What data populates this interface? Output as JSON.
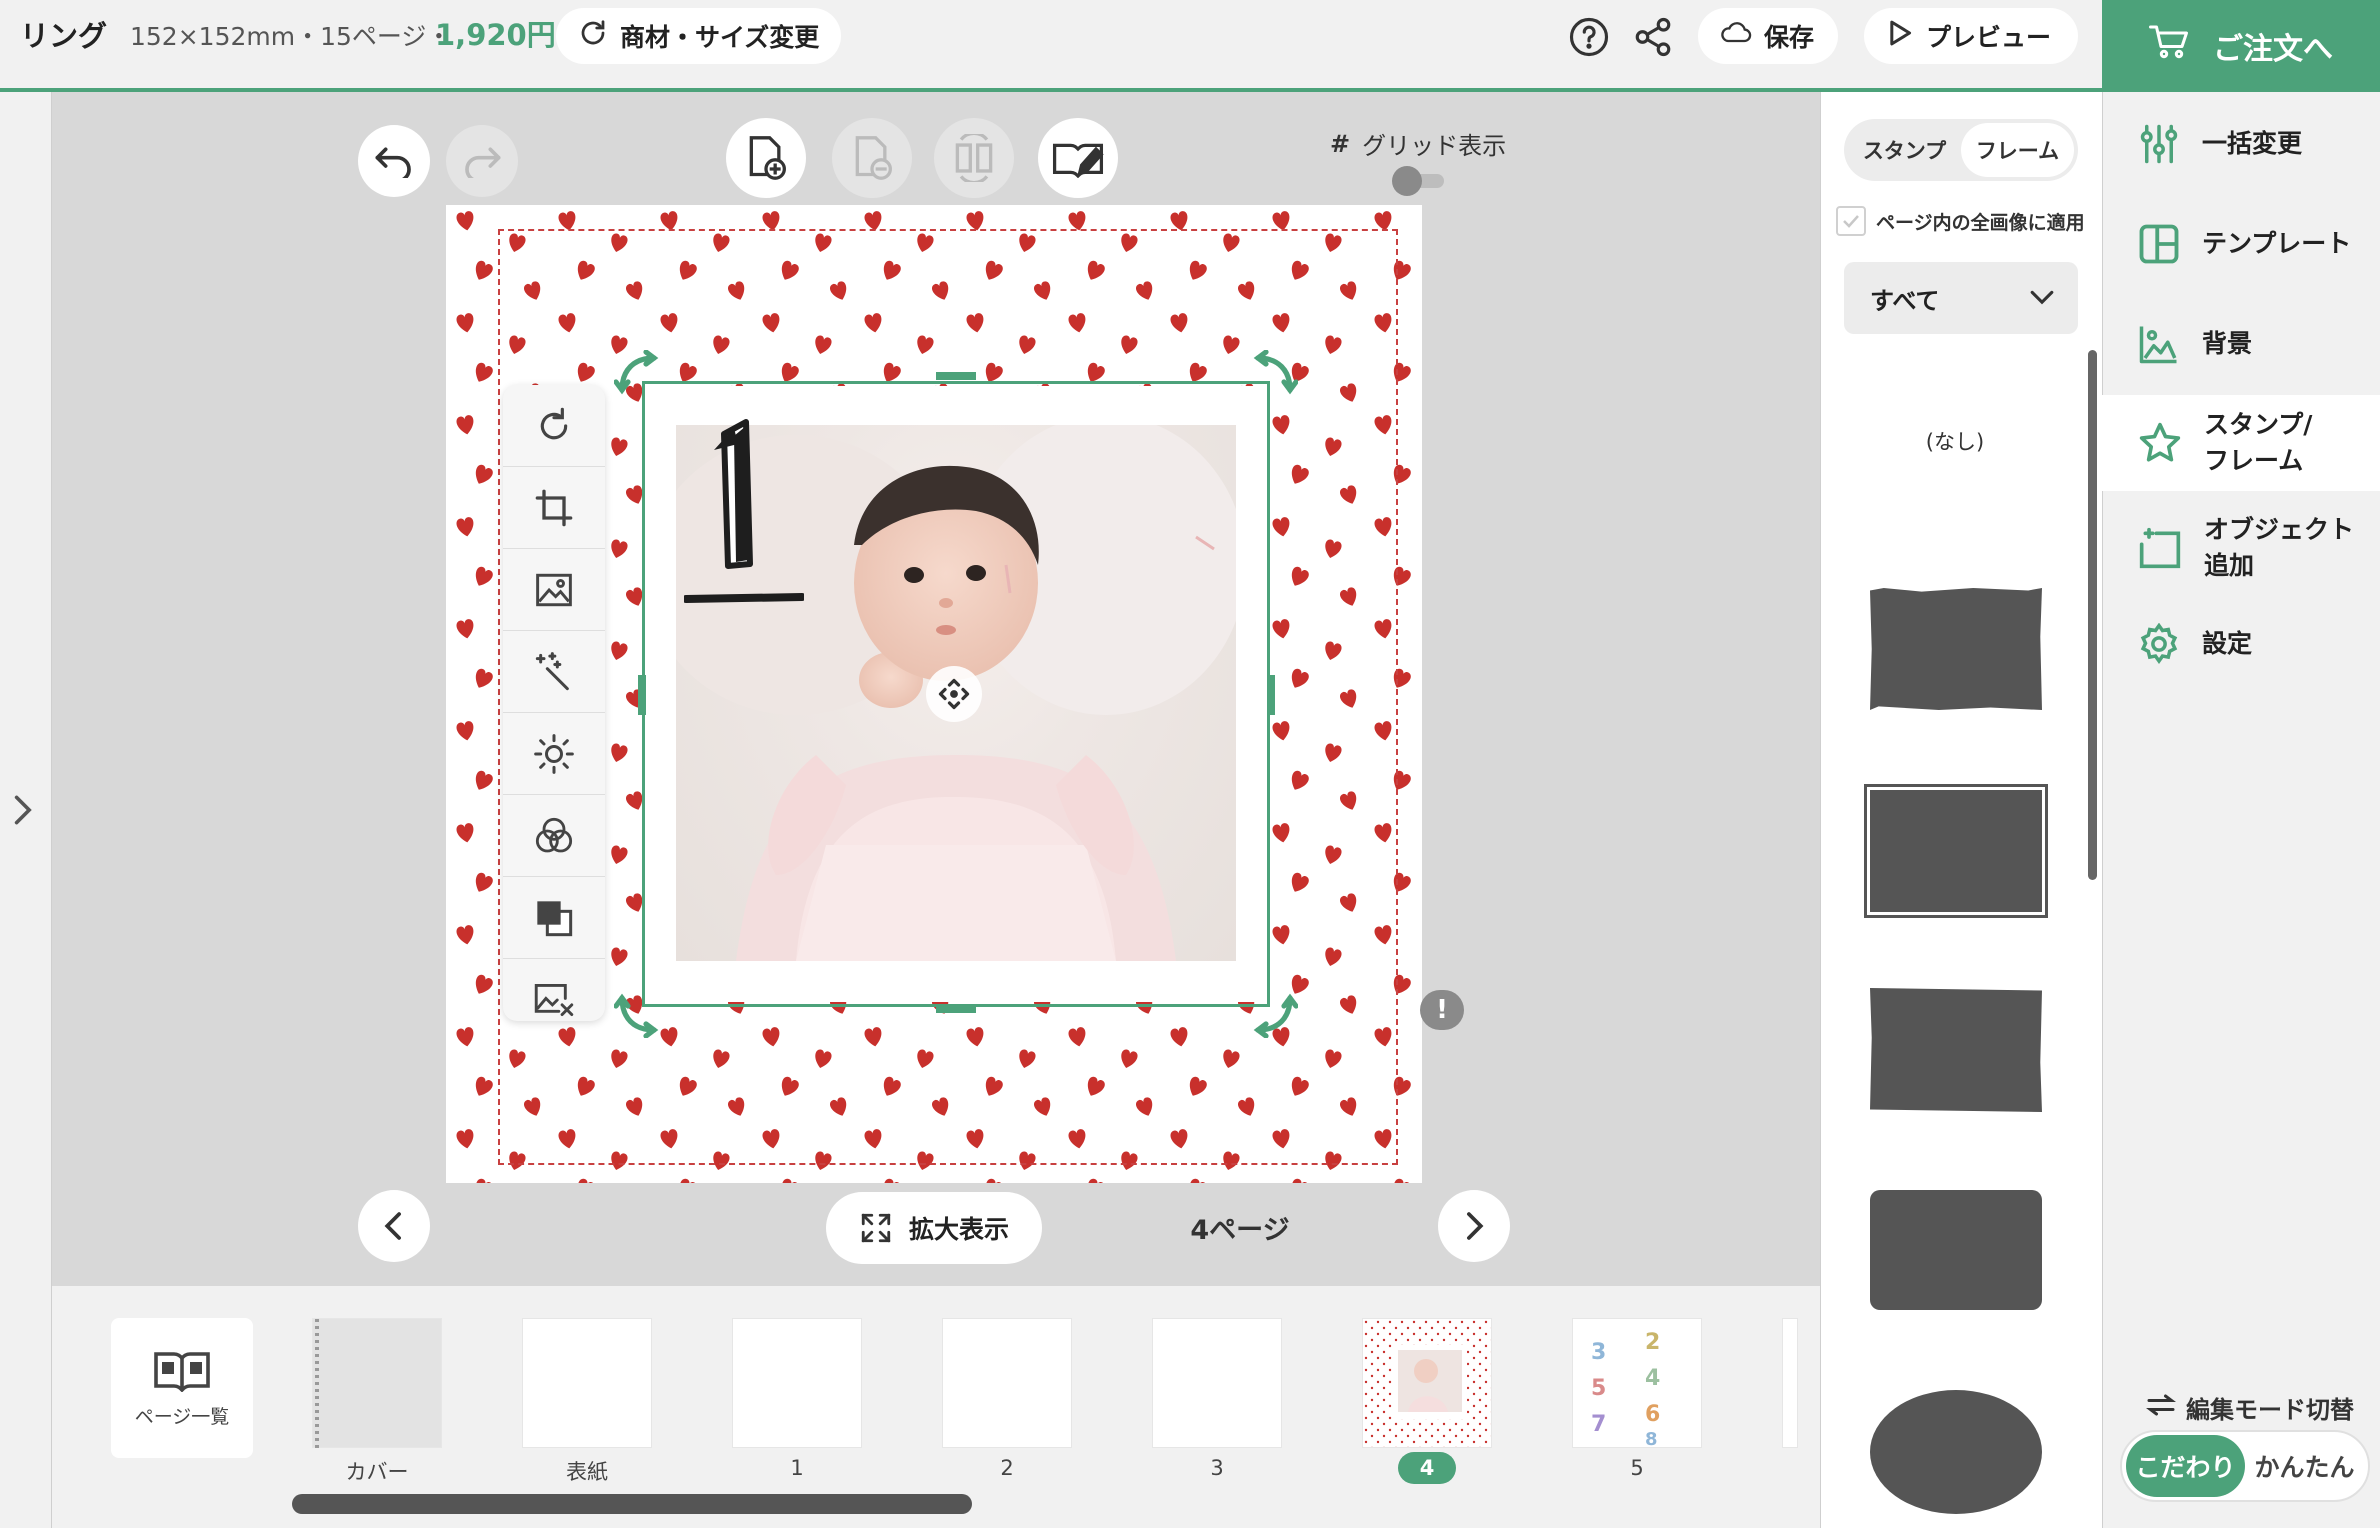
{
  "header": {
    "title": "リング",
    "spec": "152×152mm・15ページ・",
    "price": "1,920円",
    "change_button": "商材・サイズ変更",
    "save_button": "保存",
    "preview_button": "プレビュー",
    "order_button": "ご注文へ"
  },
  "editor": {
    "grid_label": "グリッド表示",
    "zoom_button": "拡大表示",
    "page_indicator": "4ページ"
  },
  "stamp_panel": {
    "tabs": [
      {
        "label": "スタンプ"
      },
      {
        "label": "フレーム",
        "active": true
      }
    ],
    "apply_all_label": "ページ内の全画像に適用",
    "category": "すべて",
    "none_label": "(なし)"
  },
  "thumbnails": {
    "page_list_label": "ページ一覧",
    "items": [
      {
        "label": "カバー"
      },
      {
        "label": "表紙"
      },
      {
        "label": "1"
      },
      {
        "label": "2"
      },
      {
        "label": "3"
      },
      {
        "label": "4",
        "active": true
      },
      {
        "label": "5"
      }
    ]
  },
  "menu": {
    "items": [
      {
        "label": "一括変更",
        "icon": "sliders-icon"
      },
      {
        "label": "テンプレート",
        "icon": "template-icon"
      },
      {
        "label": "背景",
        "icon": "background-icon"
      },
      {
        "label": "スタンプ/\nフレーム",
        "icon": "star-icon",
        "active": true
      },
      {
        "label": "オブジェクト\n追加",
        "icon": "add-object-icon"
      },
      {
        "label": "設定",
        "icon": "gear-icon"
      }
    ],
    "mode_switch_label": "編集モード切替",
    "modes": [
      {
        "label": "こだわり",
        "active": true
      },
      {
        "label": "かんたん"
      }
    ]
  },
  "colors": {
    "accent": "#4ca27a",
    "heart": "#c8302c",
    "dashed_guide": "#c84040"
  }
}
